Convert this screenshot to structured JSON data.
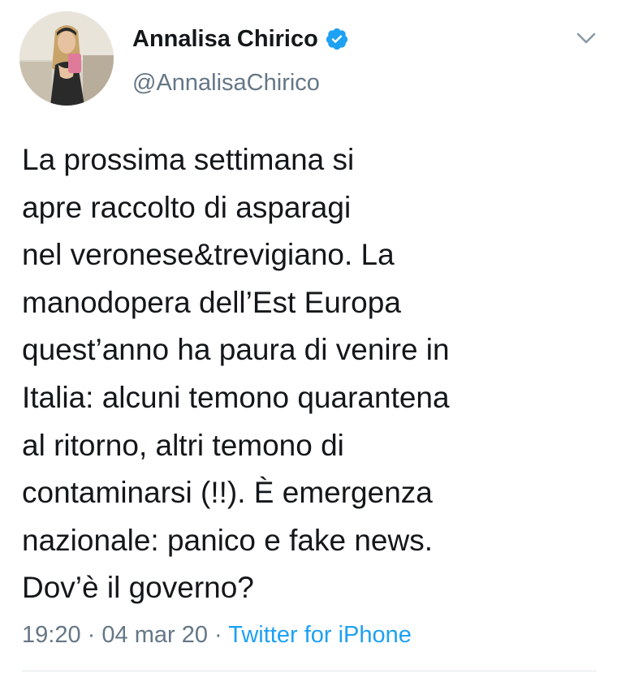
{
  "author": {
    "name": "Annalisa Chirico",
    "handle": "@AnnalisaChirico",
    "verified": true
  },
  "tweet": {
    "text": "La prossima settimana si\napre raccolto di asparagi\nnel veronese&trevigiano. La\nmanodopera dell’Est Europa\nquest’anno ha paura di venire in\nItalia: alcuni temono quarantena\nal ritorno, altri temono di\ncontaminarsi (!!). È emergenza\nnazionale: panico e fake news.\nDov’è il governo?",
    "time": "19:20",
    "separator": "·",
    "date": "04 mar 20",
    "source": "Twitter for iPhone"
  },
  "icons": {
    "verified": "verified-badge-icon",
    "menu": "chevron-down-icon"
  },
  "colors": {
    "text": "#14171a",
    "secondary": "#657786",
    "accent": "#1da1f2",
    "divider": "#e1e8ed"
  }
}
